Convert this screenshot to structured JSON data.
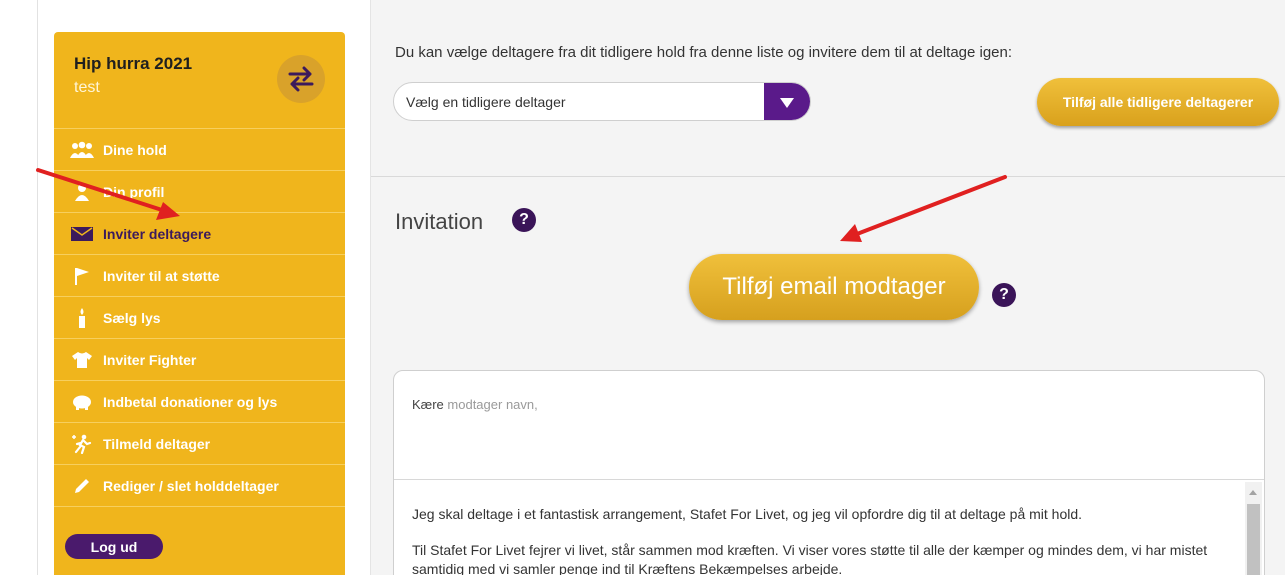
{
  "sidebar": {
    "team_name": "Hip hurra 2021",
    "team_sub": "test",
    "items": [
      {
        "label": "Dine hold",
        "icon": "people-icon"
      },
      {
        "label": "Din profil",
        "icon": "person-icon"
      },
      {
        "label": "Inviter deltagere",
        "icon": "envelope-icon",
        "active": true
      },
      {
        "label": "Inviter til at støtte",
        "icon": "flag-icon"
      },
      {
        "label": "Sælg lys",
        "icon": "candle-icon"
      },
      {
        "label": "Inviter Fighter",
        "icon": "tshirt-icon"
      },
      {
        "label": "Indbetal donationer og lys",
        "icon": "piggy-bank-icon"
      },
      {
        "label": "Tilmeld deltager",
        "icon": "runner-plus-icon"
      },
      {
        "label": "Rediger / slet holddeltager",
        "icon": "pencil-icon"
      }
    ],
    "logout_label": "Log ud"
  },
  "main": {
    "intro_text": "Du kan vælge deltagere fra dit tidligere hold fra denne liste og invitere dem til at deltage igen:",
    "select_placeholder": "Vælg en tidligere deltager",
    "add_all_label": "Tilføj alle tidligere deltagerer",
    "invitation_title": "Invitation",
    "help_glyph": "?",
    "add_email_label": "Tilføj email modtager",
    "message": {
      "greeting_prefix": "Kære ",
      "greeting_placeholder": "modtager navn,",
      "paragraph_1": "Jeg skal deltage i et fantastisk arrangement, Stafet For Livet, og jeg vil opfordre dig til at deltage på mit hold.",
      "paragraph_2": "Til Stafet For Livet fejrer vi livet, står sammen mod kræften. Vi viser vores støtte til alle der kæmper og mindes dem, vi har mistet samtidig med vi samler penge ind til Kræftens Bekæmpelses arbejde."
    }
  },
  "colors": {
    "sidebar_bg": "#f0b51c",
    "accent_purple": "#4a1a6c",
    "button_gold": "#e0ac25",
    "annotation_red": "#e02020"
  }
}
